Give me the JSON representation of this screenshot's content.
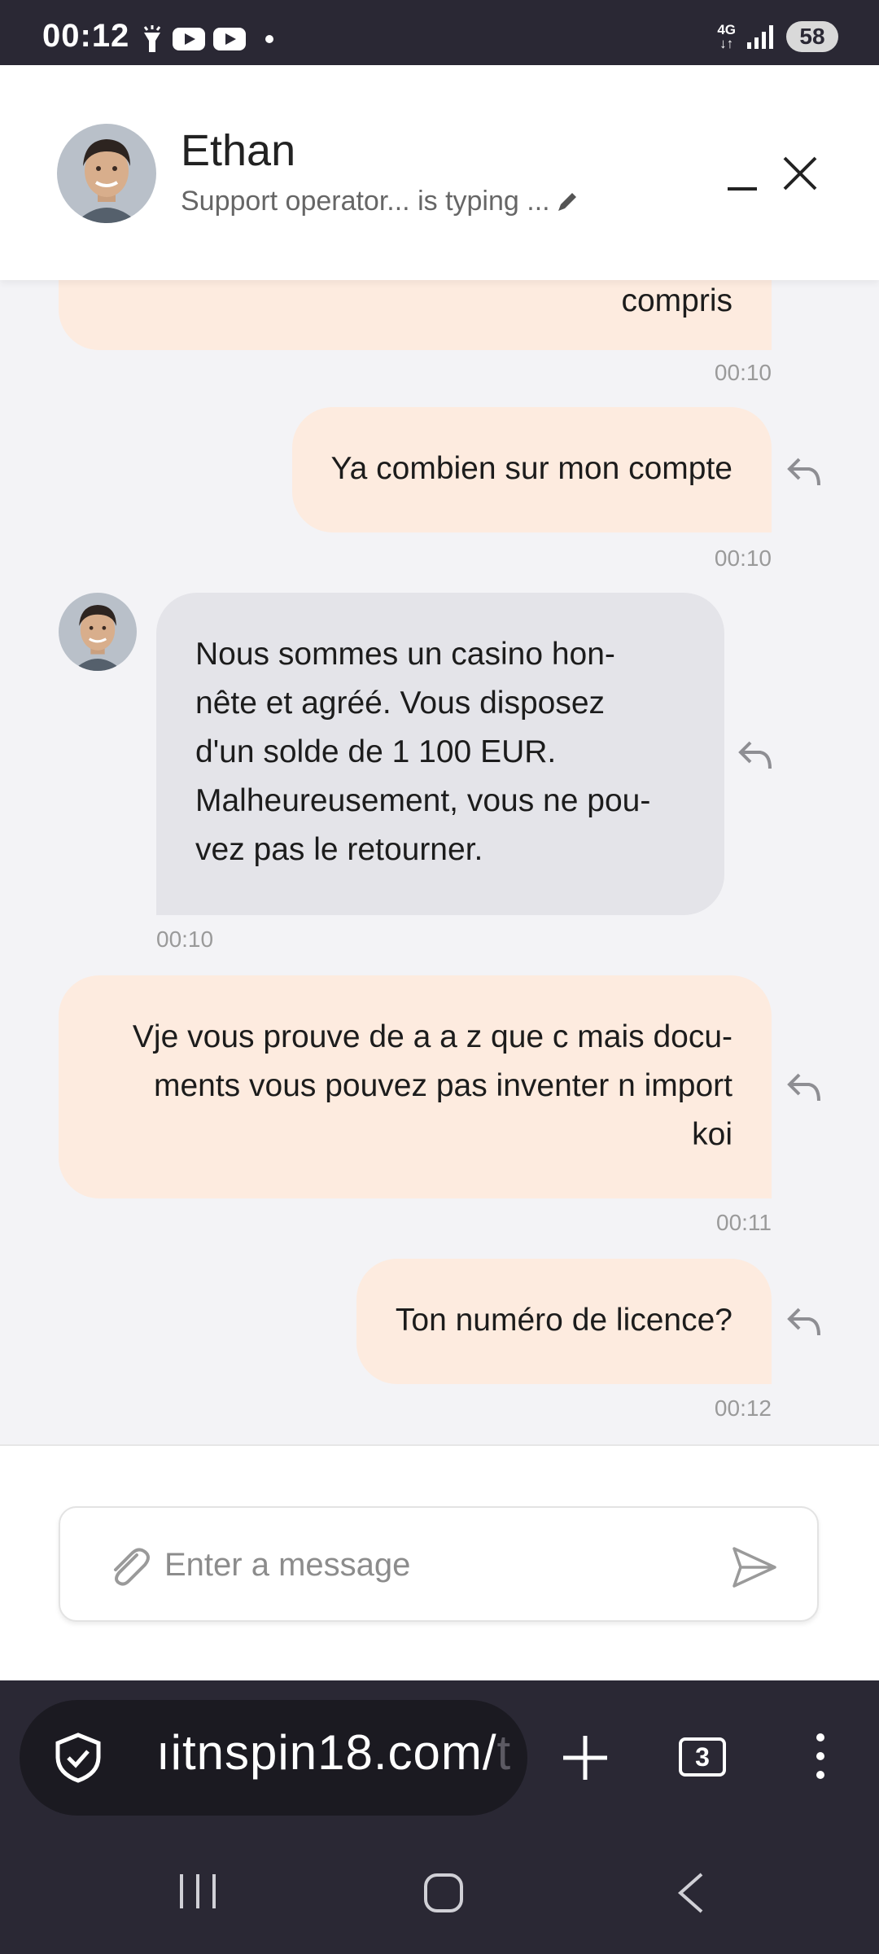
{
  "status_bar": {
    "time": "00:12",
    "network": "4G",
    "battery": "58"
  },
  "header": {
    "name": "Ethan",
    "status": "Support operator... is typing ..."
  },
  "messages": [
    {
      "sender": "user",
      "text": "compris",
      "time": "00:10"
    },
    {
      "sender": "user",
      "text": "Ya combien sur mon compte",
      "time": "00:10"
    },
    {
      "sender": "operator",
      "lines": [
        "Nous sommes un casino hon-",
        "nête et agréé. Vous disposez",
        "d'un solde de 1 100 EUR.",
        "Malheureusement, vous ne pou-",
        "vez pas le retourner."
      ],
      "time": "00:10"
    },
    {
      "sender": "user",
      "lines": [
        "Vje vous prouve de a a z que c mais docu-",
        "ments vous pouvez pas inventer n import",
        "koi"
      ],
      "time": "00:11"
    },
    {
      "sender": "user",
      "text": "Ton numéro de licence?",
      "time": "00:12"
    }
  ],
  "composer": {
    "placeholder": "Enter a message"
  },
  "browser": {
    "url": "ıitnspin18.com/",
    "url_fade": "t",
    "tab_count": "3"
  }
}
